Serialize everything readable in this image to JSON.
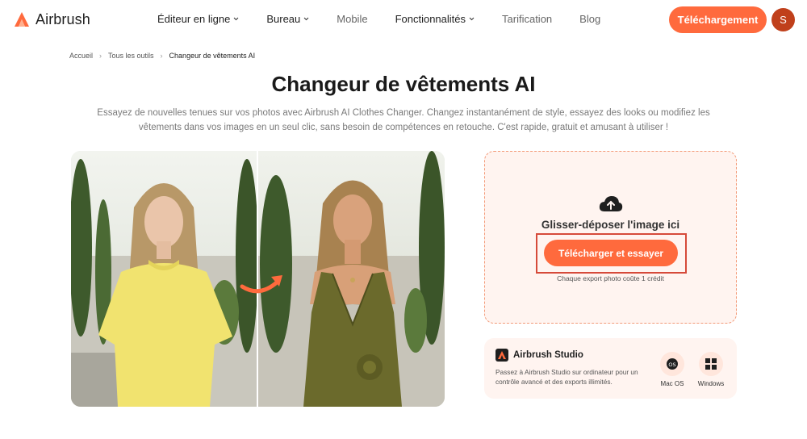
{
  "brand": {
    "name": "Airbrush",
    "accent": "#ff6a3d",
    "highlight": "#d64a3a"
  },
  "nav": {
    "items": [
      {
        "label": "Éditeur en ligne",
        "dropdown": true
      },
      {
        "label": "Bureau",
        "dropdown": true
      },
      {
        "label": "Mobile",
        "dropdown": false
      },
      {
        "label": "Fonctionnalités",
        "dropdown": true
      },
      {
        "label": "Tarification",
        "dropdown": false
      },
      {
        "label": "Blog",
        "dropdown": false
      }
    ],
    "download_label": "Téléchargement",
    "avatar_initial": "S"
  },
  "breadcrumb": [
    "Accueil",
    "Tous les outils",
    "Changeur de vêtements AI"
  ],
  "hero": {
    "title": "Changeur de vêtements AI",
    "subtitle": "Essayez de nouvelles tenues sur vos photos avec Airbrush AI Clothes Changer. Changez instantanément de style, essayez des looks ou modifiez les vêtements dans vos images en un seul clic, sans besoin de compétences en retouche. C'est rapide, gratuit et amusant à utiliser !"
  },
  "compare": {
    "before_outfit": "yellow-tshirt",
    "after_outfit": "olive-satin-dress",
    "arrow_icon": "curved-arrow-icon"
  },
  "upload": {
    "icon": "cloud-upload-icon",
    "drop_text": "Glisser-déposer l'image ici",
    "button_label": "Télécharger et essayer",
    "credit_note": "Chaque export photo coûte 1 crédit"
  },
  "studio": {
    "title": "Airbrush Studio",
    "description": "Passez à Airbrush Studio sur ordinateur pour un contrôle avancé et des exports illimités.",
    "platforms": [
      {
        "label": "Mac OS",
        "icon": "macos-icon"
      },
      {
        "label": "Windows",
        "icon": "windows-icon"
      }
    ]
  }
}
